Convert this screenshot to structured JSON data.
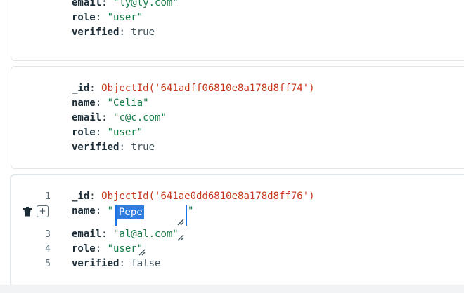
{
  "documents": [
    {
      "fields": [
        {
          "key": "email",
          "value": "\"ly@ly.com\""
        },
        {
          "key": "role",
          "value": "\"user\""
        },
        {
          "key": "verified",
          "value": "true"
        }
      ]
    },
    {
      "fields": [
        {
          "key": "_id",
          "value": "ObjectId('641adff06810e8a178d8ff74')"
        },
        {
          "key": "name",
          "value": "\"Celia\""
        },
        {
          "key": "email",
          "value": "\"c@c.com\""
        },
        {
          "key": "role",
          "value": "\"user\""
        },
        {
          "key": "verified",
          "value": "true"
        }
      ]
    },
    {
      "line_numbers": [
        "1",
        "3",
        "4",
        "5"
      ],
      "fields": [
        {
          "key": "_id",
          "value": "ObjectId('641ae0dd6810e8a178d8ff76')"
        },
        {
          "key": "name",
          "value": "\"",
          "edit_value": "Pepe",
          "close_quote": "\""
        },
        {
          "key": "email",
          "value": "\"al@al.com\""
        },
        {
          "key": "role",
          "value": "\"user\""
        },
        {
          "key": "verified",
          "value": "false"
        }
      ]
    }
  ],
  "colors": {
    "key": "#1c2d38",
    "string": "#177d48",
    "object_id": "#c7371b",
    "selection": "#2f7de1",
    "caret": "#1a73e8"
  },
  "icons": {
    "delete": "trash-icon",
    "add_field": "plus-icon",
    "resize": "resize-handle-icon"
  }
}
